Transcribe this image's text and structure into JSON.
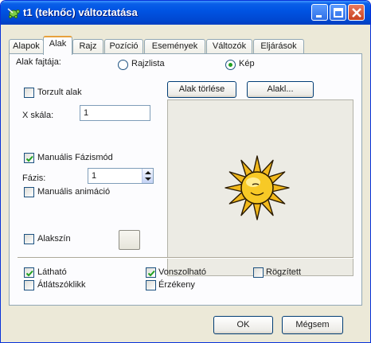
{
  "window": {
    "title": "t1 (teknőc) változtatása"
  },
  "tabs": [
    {
      "label": "Alapok"
    },
    {
      "label": "Alak"
    },
    {
      "label": "Rajz"
    },
    {
      "label": "Pozíció"
    },
    {
      "label": "Események"
    },
    {
      "label": "Változók"
    },
    {
      "label": "Eljárások"
    }
  ],
  "shape": {
    "type_label": "Alak fajtája:",
    "radio_drawing_list": "Rajzlista",
    "radio_image": "Kép",
    "selected": "Kép",
    "distorted_label": "Torzult alak",
    "distorted_checked": false,
    "delete_button": "Alak törlése",
    "shape_button": "Alakl...",
    "x_scale_label": "X skála:",
    "x_scale_value": "1",
    "manual_phase_label": "Manuális Fázismód",
    "manual_phase_checked": true,
    "phase_label": "Fázis:",
    "phase_value": "1",
    "manual_anim_label": "Manuális animáció",
    "manual_anim_checked": false,
    "shape_color_label": "Alakszín",
    "shape_color_checked": false,
    "preview_icon": "sun-icon"
  },
  "options": {
    "visible_label": "Látható",
    "visible_checked": true,
    "draggable_label": "Vonszolható",
    "draggable_checked": true,
    "fixed_label": "Rögzített",
    "fixed_checked": false,
    "clickthrough_label": "Átlátszóklikk",
    "clickthrough_checked": false,
    "sensitive_label": "Érzékeny",
    "sensitive_checked": false
  },
  "footer": {
    "ok_label": "OK",
    "cancel_label": "Mégsem"
  },
  "colors": {
    "title_blue": "#0054e3",
    "tab_highlight": "#e7a13c",
    "check_green": "#21a121"
  }
}
